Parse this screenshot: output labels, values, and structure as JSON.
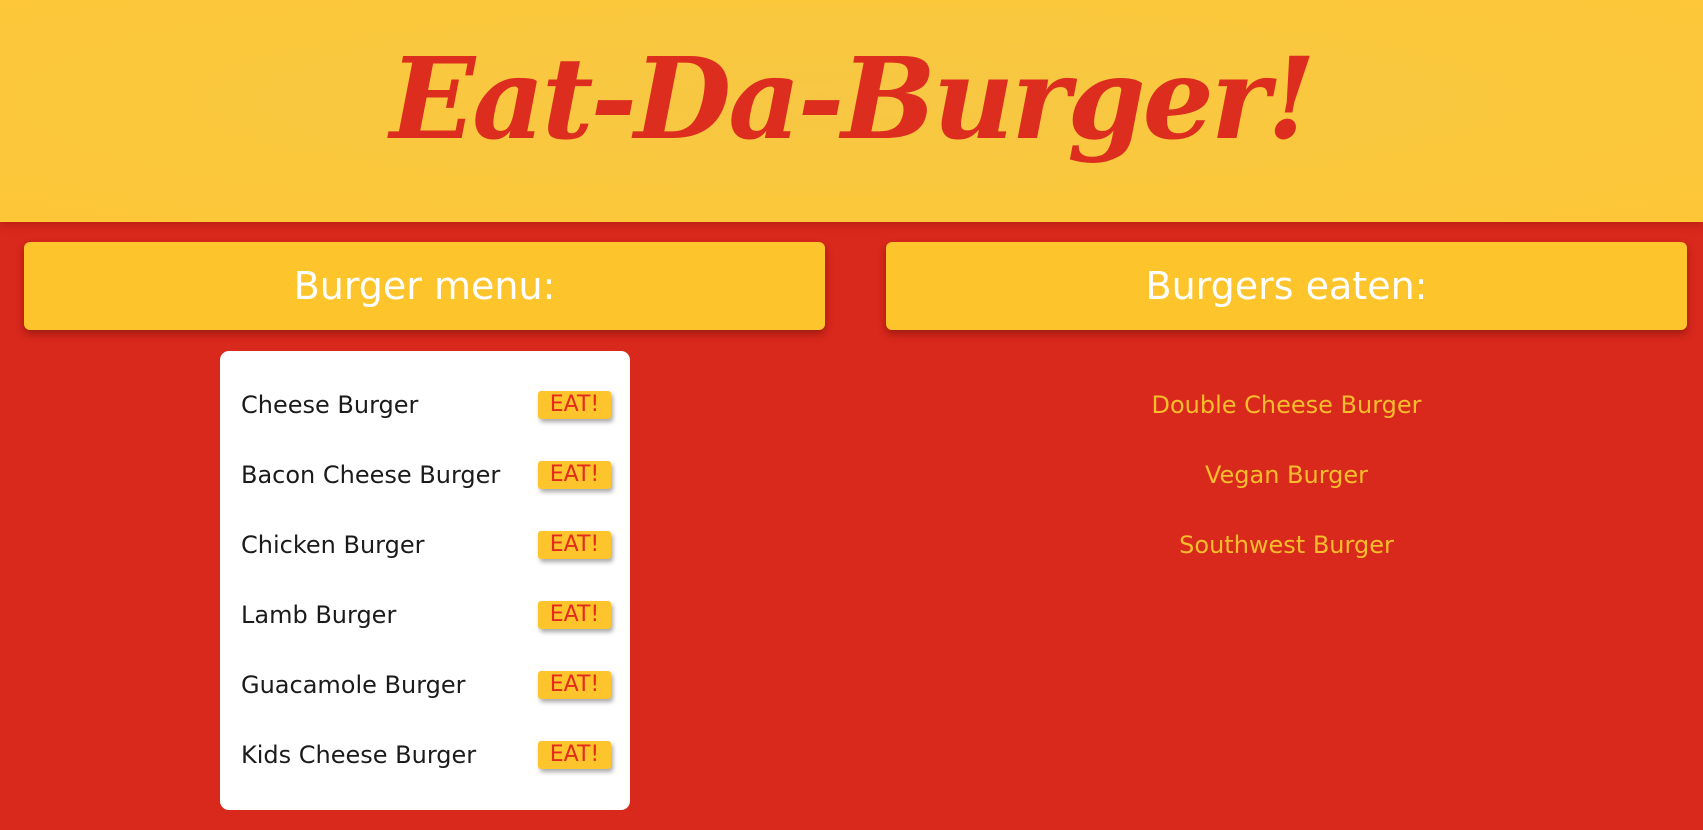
{
  "header": {
    "title": "Eat-Da-Burger!"
  },
  "menu": {
    "heading": "Burger menu:",
    "eat_label": "EAT!",
    "items": [
      {
        "name": "Cheese Burger"
      },
      {
        "name": "Bacon Cheese Burger"
      },
      {
        "name": "Chicken Burger"
      },
      {
        "name": "Lamb Burger"
      },
      {
        "name": "Guacamole Burger"
      },
      {
        "name": "Kids Cheese Burger"
      }
    ]
  },
  "eaten": {
    "heading": "Burgers eaten:",
    "items": [
      {
        "name": "Double Cheese Burger"
      },
      {
        "name": "Vegan Burger"
      },
      {
        "name": "Southwest Burger"
      }
    ]
  },
  "colors": {
    "background_red": "#d9281c",
    "header_yellow": "#fbc83c",
    "accent_yellow": "#fec42c",
    "title_red": "#dc2d1f",
    "eaten_text": "#f8bd2c"
  }
}
